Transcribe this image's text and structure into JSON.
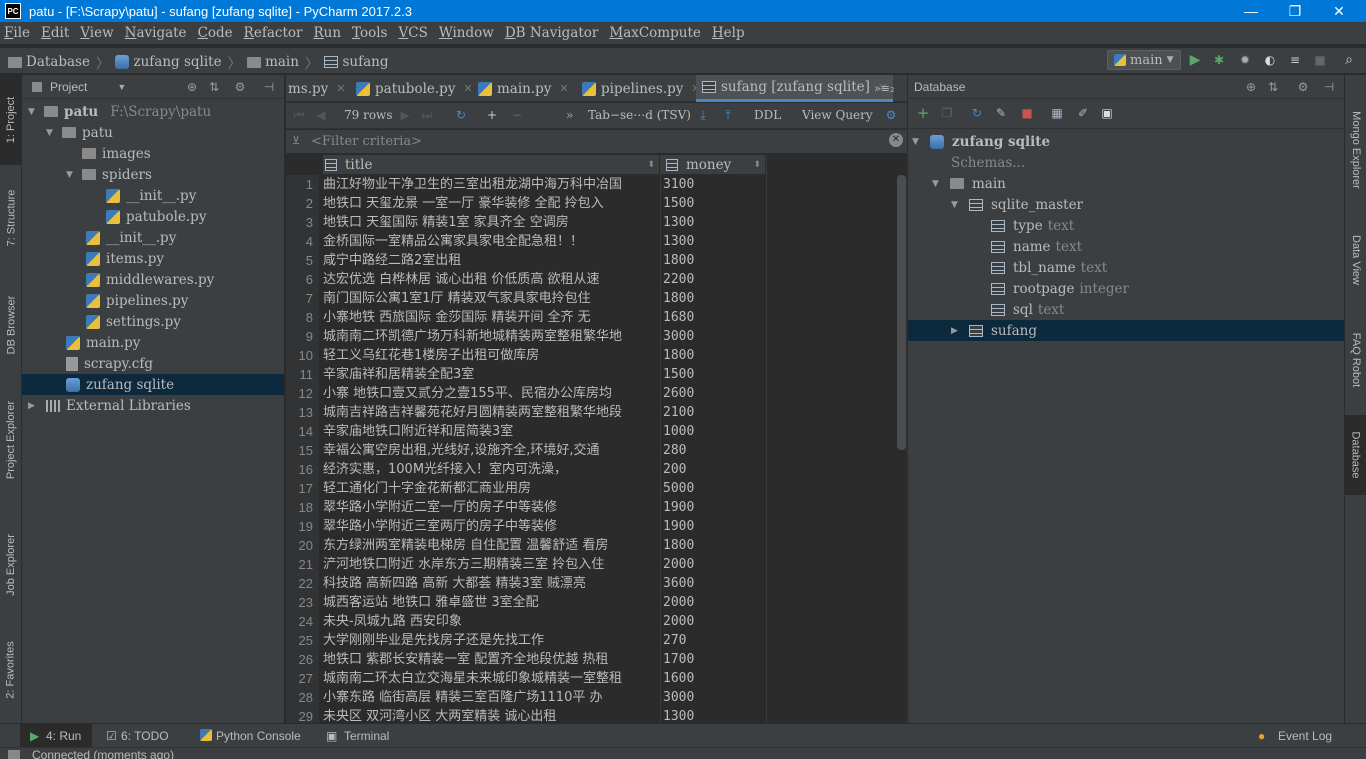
{
  "window": {
    "title": "patu - [F:\\Scrapy\\patu] - sufang [zufang sqlite] - PyCharm 2017.2.3",
    "app_icon": "PC",
    "minimize": "—",
    "maximize": "❐",
    "close": "✕"
  },
  "menu": [
    "File",
    "Edit",
    "View",
    "Navigate",
    "Code",
    "Refactor",
    "Run",
    "Tools",
    "VCS",
    "Window",
    "DB Navigator",
    "MaxCompute",
    "Help"
  ],
  "breadcrumb": [
    "Database",
    "zufang sqlite",
    "main",
    "sufang"
  ],
  "run_config": "main",
  "project_panel": {
    "title": "Project",
    "tree": [
      {
        "label": "patu",
        "extra": "F:\\Scrapy\\patu",
        "icon": "folder-icon"
      },
      {
        "label": "patu",
        "icon": "folder-icon"
      },
      {
        "label": "images",
        "icon": "folder-icon"
      },
      {
        "label": "spiders",
        "icon": "folder-icon"
      },
      {
        "label": "__init__.py",
        "icon": "python-file-icon"
      },
      {
        "label": "patubole.py",
        "icon": "python-file-icon"
      },
      {
        "label": "__init__.py",
        "icon": "python-file-icon"
      },
      {
        "label": "items.py",
        "icon": "python-file-icon"
      },
      {
        "label": "middlewares.py",
        "icon": "python-file-icon"
      },
      {
        "label": "pipelines.py",
        "icon": "python-file-icon"
      },
      {
        "label": "settings.py",
        "icon": "python-file-icon"
      },
      {
        "label": "main.py",
        "icon": "python-file-icon"
      },
      {
        "label": "scrapy.cfg",
        "icon": "config-file-icon"
      },
      {
        "label": "zufang sqlite",
        "icon": "database-icon"
      },
      {
        "label": "External Libraries",
        "icon": "library-icon"
      }
    ]
  },
  "left_tool_tabs": [
    "1: Project",
    "7: Structure",
    "DB Browser",
    "Project Explorer",
    "Job Explorer",
    "2: Favorites"
  ],
  "right_tool_tabs": [
    "Mongo Explorer",
    "Data View",
    "FAQ Robot",
    "Database"
  ],
  "editor_tabs": [
    {
      "label": "ms.py"
    },
    {
      "label": "patubole.py"
    },
    {
      "label": "main.py"
    },
    {
      "label": "pipelines.py"
    },
    {
      "label": "sufang [zufang sqlite]"
    }
  ],
  "editor_tab_overflow": "»≡₂",
  "grid_toolbar": {
    "rows": "79 rows",
    "format": "Tab−se⋯d (TSV)",
    "ddl": "DDL",
    "view_query": "View Query"
  },
  "filter_placeholder": "<Filter criteria>",
  "columns": [
    "title",
    "money"
  ],
  "rows": [
    [
      "曲江好物业干净卫生的三室出租龙湖中海万科中冶国",
      "3100"
    ],
    [
      "地铁口 天玺龙景 一室一厅 豪华装修 全配 拎包入",
      "1500"
    ],
    [
      "地铁口 天玺国际  精装1室 家具齐全 空调房",
      "1300"
    ],
    [
      "金桥国际一室精品公寓家具家电全配急租！！",
      "1300"
    ],
    [
      "咸宁中路经二路2室出租",
      "1800"
    ],
    [
      "达宏优选 白桦林居 诚心出租 价低质高 欲租从速",
      "2200"
    ],
    [
      "南门国际公寓1室1厅 精装双气家具家电拎包住",
      "1800"
    ],
    [
      "小寨地铁 西旅国际 金莎国际 精装开间 全齐 无",
      "1680"
    ],
    [
      "城南南二环凯德广场万科新地城精装两室整租繁华地",
      "3000"
    ],
    [
      "轻工义乌红花巷1楼房子出租可做库房",
      "1800"
    ],
    [
      "辛家庙祥和居精装全配3室",
      "1500"
    ],
    [
      "小寨 地铁口壹又贰分之壹155平、民宿办公库房均",
      "2600"
    ],
    [
      "城南吉祥路吉祥馨苑花好月圆精装两室整租繁华地段",
      "2100"
    ],
    [
      "辛家庙地铁口附近祥和居简装3室",
      "1000"
    ],
    [
      "幸福公寓空房出租,光线好,设施齐全,环境好,交通",
      "280"
    ],
    [
      "经济实惠，100M光纤接入！室内可洗澡，",
      "200"
    ],
    [
      "轻工通化门十字金花新都汇商业用房",
      "5000"
    ],
    [
      "翠华路小学附近二室一厅的房子中等装修",
      "1900"
    ],
    [
      "翠华路小学附近三室两厅的房子中等装修",
      "1900"
    ],
    [
      "东方绿洲两室精装电梯房 自住配置 温馨舒适 看房",
      "1800"
    ],
    [
      "浐河地铁口附近 水岸东方三期精装三室 拎包入住",
      "2000"
    ],
    [
      "科技路 高新四路 高新 大都荟 精装3室 贼漂亮",
      "3600"
    ],
    [
      "城西客运站 地铁口 雅卓盛世 3室全配",
      "2000"
    ],
    [
      "未央-凤城九路 西安印象",
      "2000"
    ],
    [
      "大学刚刚毕业是先找房子还是先找工作",
      "270"
    ],
    [
      "地铁口 紫郡长安精装一室 配置齐全地段优越 热租",
      "1700"
    ],
    [
      "城南南二环太白立交海星未来城印象城精装一室整租",
      "1600"
    ],
    [
      "小寨东路 临街高层 精装三室百隆广场1110平 办",
      "3000"
    ],
    [
      "未央区  双河湾小区  大两室精装 诚心出租",
      "1300"
    ]
  ],
  "database_panel": {
    "title": "Database",
    "tree": [
      {
        "label": "zufang sqlite",
        "type": ""
      },
      {
        "label": "Schemas...",
        "type": ""
      },
      {
        "label": "main",
        "type": ""
      },
      {
        "label": "sqlite_master",
        "type": ""
      },
      {
        "label": "type",
        "type": "text"
      },
      {
        "label": "name",
        "type": "text"
      },
      {
        "label": "tbl_name",
        "type": "text"
      },
      {
        "label": "rootpage",
        "type": "integer"
      },
      {
        "label": "sql",
        "type": "text"
      },
      {
        "label": "sufang",
        "type": ""
      }
    ]
  },
  "bottom_tabs": [
    "4: Run",
    "6: TODO",
    "Python Console",
    "Terminal"
  ],
  "event_log": "Event Log",
  "status": "Connected (moments ago)"
}
